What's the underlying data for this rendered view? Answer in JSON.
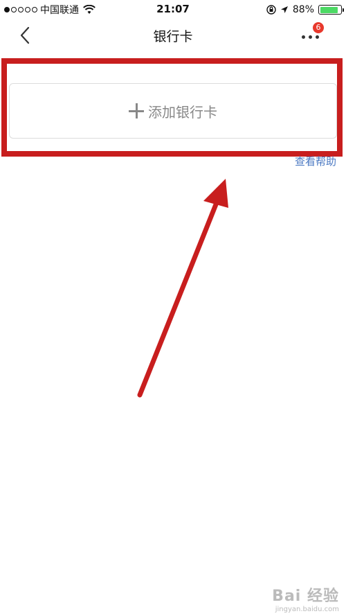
{
  "status_bar": {
    "carrier": "中国联通",
    "time": "21:07",
    "battery_percent": "88%",
    "battery_level": 0.88,
    "signal_bars_filled": 1,
    "signal_bars_total": 5
  },
  "nav": {
    "title": "银行卡",
    "badge_count": "6"
  },
  "main": {
    "add_card_label": "添加银行卡",
    "help_link": "查看帮助"
  },
  "annotation": {
    "highlight_color": "#c81e1e"
  },
  "watermark": {
    "logo": "Bai 经验",
    "domain": "jingyan.baidu.com"
  },
  "colors": {
    "accent_link": "#4a78c2",
    "badge": "#e8382c",
    "battery": "#4cd964"
  }
}
